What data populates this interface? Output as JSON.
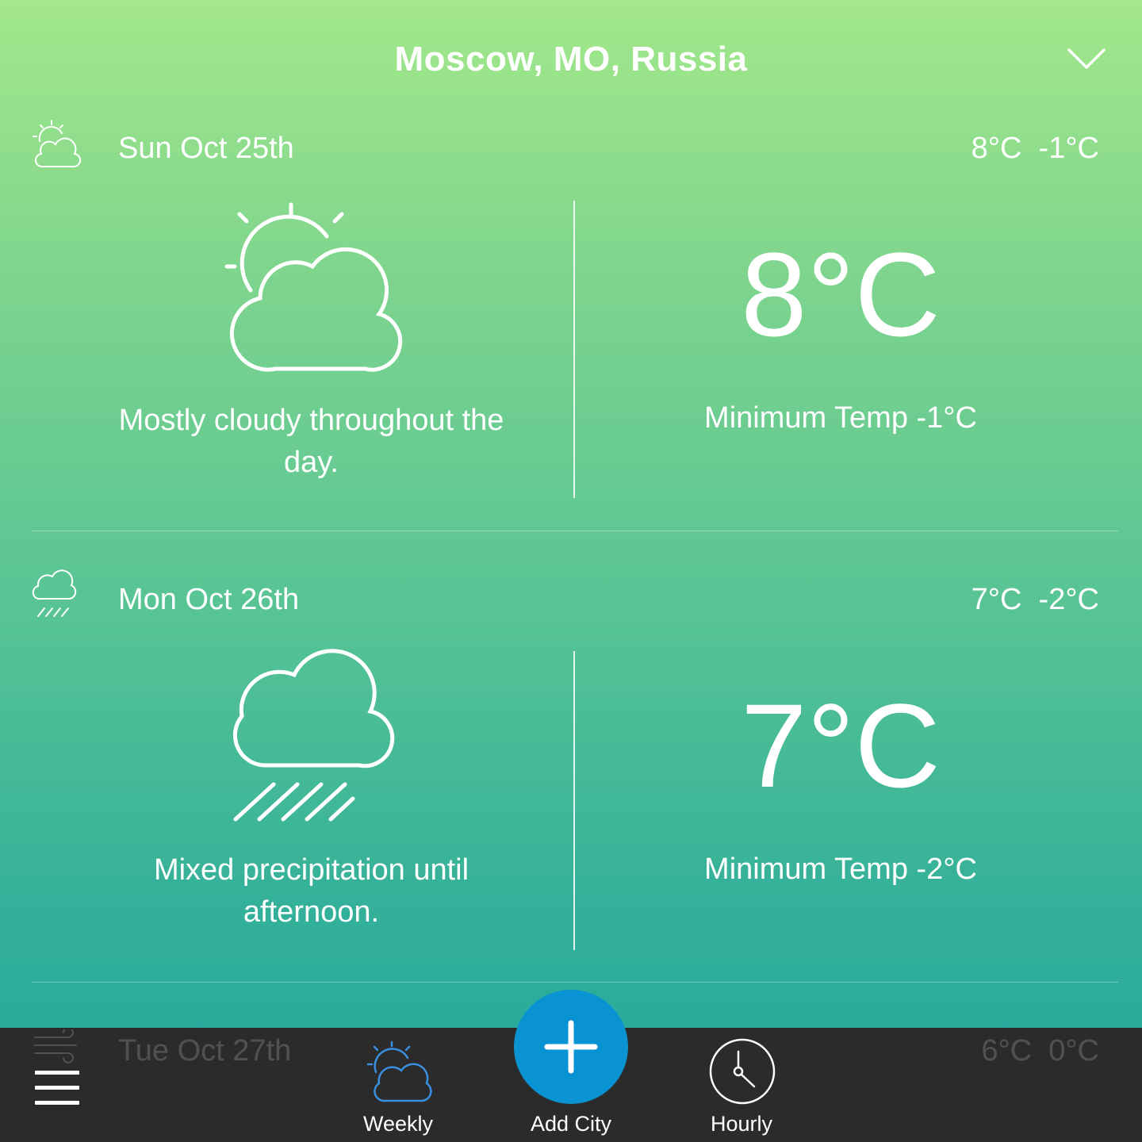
{
  "header": {
    "city": "Moscow, MO, Russia",
    "dropdown_icon": "chevron-down-icon"
  },
  "days": [
    {
      "date": "Sun Oct 25th",
      "range": "8°C  -1°C",
      "icon": "partly-cloudy-icon",
      "description": "Mostly cloudy throughout the day.",
      "high": "8°C",
      "min_text": "Minimum Temp -1°C"
    },
    {
      "date": "Mon Oct 26th",
      "range": "7°C  -2°C",
      "icon": "rain-cloud-icon",
      "description": "Mixed precipitation until afternoon.",
      "high": "7°C",
      "min_text": "Minimum Temp -2°C"
    },
    {
      "date": "Tue Oct 27th",
      "range": "6°C  0°C",
      "icon": "wind-icon"
    }
  ],
  "bottom_bar": {
    "menu_icon": "hamburger-menu-icon",
    "tabs": [
      {
        "label": "Weekly",
        "icon": "partly-cloudy-icon"
      },
      {
        "label": "Add City",
        "icon": "plus-icon"
      },
      {
        "label": "Hourly",
        "icon": "clock-icon"
      }
    ]
  },
  "colors": {
    "gradient_top": "#a3e88a",
    "gradient_bottom": "#20a59d",
    "bar": "#2b2b2b",
    "fab": "#0a93d3",
    "weekly_icon": "#3b8fe0"
  }
}
